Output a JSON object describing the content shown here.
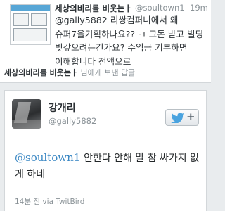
{
  "reply_tweet": {
    "display_name": "세상의비리를 비웃는ㅏ",
    "handle": "@soultown1",
    "time": "19m",
    "text": "@gally5882 리쌍컴퍼니에서 왜 슈퍼7을기획하나요?? ㅋ 그돈 받고 빌딩 빚갚으려는건가요? 수익금 기부하면 이해합니다 전액으로",
    "reply_context_name": "세상의비리를 비웃는ㅏ",
    "reply_context_suffix": "님에게 보낸 답글"
  },
  "main_tweet": {
    "display_name": "강개리",
    "handle": "@gally5882",
    "mention": "@soultown1",
    "text": "안한다 안해 말 참 싸가지 없게 하네",
    "meta": "14분 전 via TwitBird"
  },
  "colors": {
    "link": "#3b88c4",
    "twitter_bird": "#4aa3df"
  },
  "icons": {
    "follow": "twitter-bird-icon"
  }
}
